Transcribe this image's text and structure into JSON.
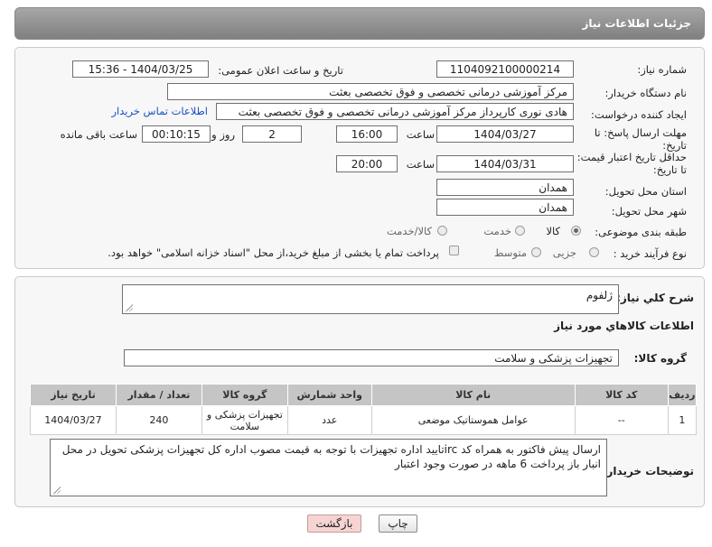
{
  "header": {
    "title": "جزئیات اطلاعات نیاز"
  },
  "form": {
    "need_number_label": "شماره نیاز:",
    "need_number": "1104092100000214",
    "announce_label": "تاریخ و ساعت اعلان عمومی:",
    "announce_value": "1404/03/25 - 15:36",
    "buyer_org_label": "نام دستگاه خریدار:",
    "buyer_org": "مرکز آموزشی درمانی تخصصی و فوق تخصصی بعثت",
    "creator_label": "ایجاد کننده درخواست:",
    "creator": "هادی نوری کارپرداز مرکز آموزشی درمانی تخصصی و فوق تخصصی بعثت",
    "contact_link": "اطلاعات تماس خریدار",
    "deadline_label": "مهلت ارسال پاسخ: تا تاریخ:",
    "deadline_date": "1404/03/27",
    "time_label": "ساعت",
    "deadline_time": "16:00",
    "days_value": "2",
    "days_label": "روز و",
    "remaining_value": "00:10:15",
    "remaining_label": "ساعت باقی مانده",
    "validity_label": "حداقل تاریخ اعتبار قیمت: تا تاریخ:",
    "validity_date": "1404/03/31",
    "validity_time": "20:00",
    "province_label": "استان محل تحویل:",
    "province": "همدان",
    "city_label": "شهر محل تحویل:",
    "city": "همدان",
    "category_label": "طبقه بندی موضوعی:",
    "category_options": [
      "کالا",
      "خدمت",
      "کالا/خدمت"
    ],
    "process_label": "نوع فرآیند خرید :",
    "process_options": [
      "جزیی",
      "متوسط"
    ],
    "payment_note": "پرداخت تمام یا بخشی از مبلغ خرید،از محل \"اسناد خزانه اسلامی\" خواهد بود."
  },
  "details": {
    "summary_label": "شرح کلي نياز:",
    "summary": "ژلفوم",
    "goods_title": "اطلاعات کالاهاي مورد نياز",
    "group_label": "گروه کالا:",
    "group": "تجهیزات پزشکی و سلامت",
    "table": {
      "headers": [
        "ردیف",
        "کد کالا",
        "نام کالا",
        "واحد شمارش",
        "گروه کالا",
        "تعداد / مقدار",
        "تاریخ نیاز"
      ],
      "rows": [
        [
          "1",
          "--",
          "عوامل هموستاتیک موضعی",
          "عدد",
          "تجهیزات پزشکی و سلامت",
          "240",
          "1404/03/27"
        ]
      ]
    },
    "buyer_notes_label": "توضیحات خریدار:",
    "buyer_notes": "ارسال پیش فاکتور به همراه کد ircتایید اداره تجهیزات  با توجه به قیمت مصوب اداره کل تجهیزات پزشکی تحویل در محل انبار باز پرداخت 6 ماهه در صورت وجود اعتبار"
  },
  "buttons": {
    "print": "چاپ",
    "back": "بازگشت"
  }
}
